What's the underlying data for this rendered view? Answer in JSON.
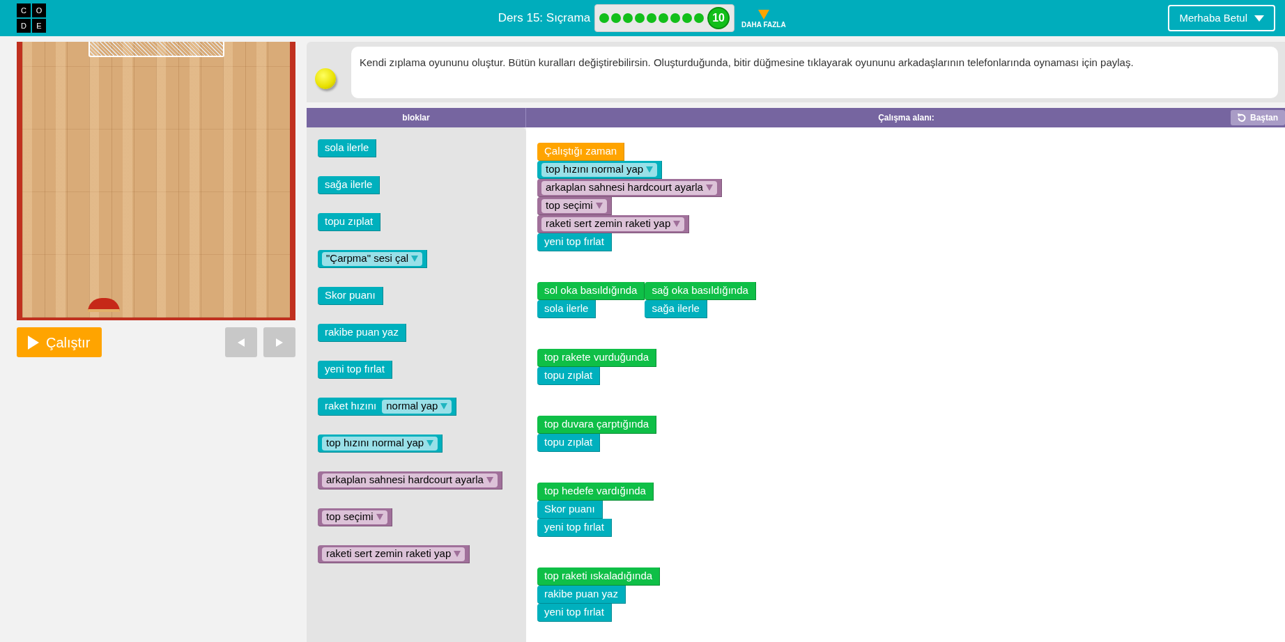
{
  "header": {
    "logo_letters": [
      "C",
      "O",
      "D",
      "E"
    ],
    "lesson_title": "Ders 15: Sıçrama",
    "progress": {
      "dots": [
        {
          "completed": true
        },
        {
          "completed": true
        },
        {
          "completed": true
        },
        {
          "completed": true
        },
        {
          "completed": true
        },
        {
          "completed": true
        },
        {
          "completed": true
        },
        {
          "completed": true
        },
        {
          "completed": true
        }
      ],
      "current": "10"
    },
    "more_label": "DAHA FAZLA",
    "user_button": "Merhaba Betul"
  },
  "controls": {
    "run_button": "Çalıştır"
  },
  "instructions": "Kendi zıplama oyununu oluştur. Bütün kuralları değiştirebilirsin. Oluşturduğunda, bitir düğmesine tıklayarak oyununu arkadaşlarının telefonlarında oynaması için paylaş.",
  "panel_headers": {
    "blocks": "bloklar",
    "workspace": "Çalışma alanı:",
    "reset_button": "Baştan"
  },
  "palette": [
    {
      "kind": "motion",
      "text": "sola ilerle"
    },
    {
      "kind": "motion",
      "text": "sağa ilerle"
    },
    {
      "kind": "motion",
      "text": "topu zıplat"
    },
    {
      "kind": "motion",
      "dropdown": "\"Çarpma\" sesi çal"
    },
    {
      "kind": "motion",
      "text": "Skor puanı"
    },
    {
      "kind": "motion",
      "text": "rakibe puan yaz"
    },
    {
      "kind": "motion",
      "text": "yeni top fırlat"
    },
    {
      "kind": "motion",
      "text": "raket hızını",
      "dropdown": "normal yap"
    },
    {
      "kind": "motion",
      "dropdown": "top hızını normal yap"
    },
    {
      "kind": "look",
      "dropdown": "arkaplan sahnesi hardcourt ayarla"
    },
    {
      "kind": "look",
      "dropdown": "top seçimi"
    },
    {
      "kind": "look",
      "dropdown": "raketi sert zemin raketi yap"
    }
  ],
  "workspace": [
    {
      "stacks": [
        [
          {
            "kind": "start",
            "text": "Çalıştığı zaman"
          },
          {
            "kind": "motion",
            "dropdown": "top hızını normal yap"
          },
          {
            "kind": "look",
            "dropdown": "arkaplan sahnesi hardcourt ayarla"
          },
          {
            "kind": "look",
            "dropdown": "top seçimi"
          },
          {
            "kind": "look",
            "dropdown": "raketi sert zemin raketi yap"
          },
          {
            "kind": "motion",
            "text": "yeni top fırlat"
          }
        ]
      ]
    },
    {
      "stacks": [
        [
          {
            "kind": "event",
            "text": "sol oka basıldığında"
          },
          {
            "kind": "motion",
            "text": "sola ilerle"
          }
        ],
        [
          {
            "kind": "event",
            "text": "sağ oka basıldığında"
          },
          {
            "kind": "motion",
            "text": "sağa ilerle"
          }
        ]
      ]
    },
    {
      "stacks": [
        [
          {
            "kind": "event",
            "text": "top rakete vurduğunda"
          },
          {
            "kind": "motion",
            "text": "topu zıplat"
          }
        ]
      ]
    },
    {
      "stacks": [
        [
          {
            "kind": "event",
            "text": "top duvara çarptığında"
          },
          {
            "kind": "motion",
            "text": "topu zıplat"
          }
        ]
      ]
    },
    {
      "stacks": [
        [
          {
            "kind": "event",
            "text": "top hedefe vardığında"
          },
          {
            "kind": "motion",
            "text": "Skor puanı"
          },
          {
            "kind": "motion",
            "text": "yeni top fırlat"
          }
        ]
      ]
    },
    {
      "stacks": [
        [
          {
            "kind": "event",
            "text": "top raketi ıskaladığında"
          },
          {
            "kind": "motion",
            "text": "rakibe puan yaz"
          },
          {
            "kind": "motion",
            "text": "yeni top fırlat"
          }
        ]
      ]
    }
  ]
}
